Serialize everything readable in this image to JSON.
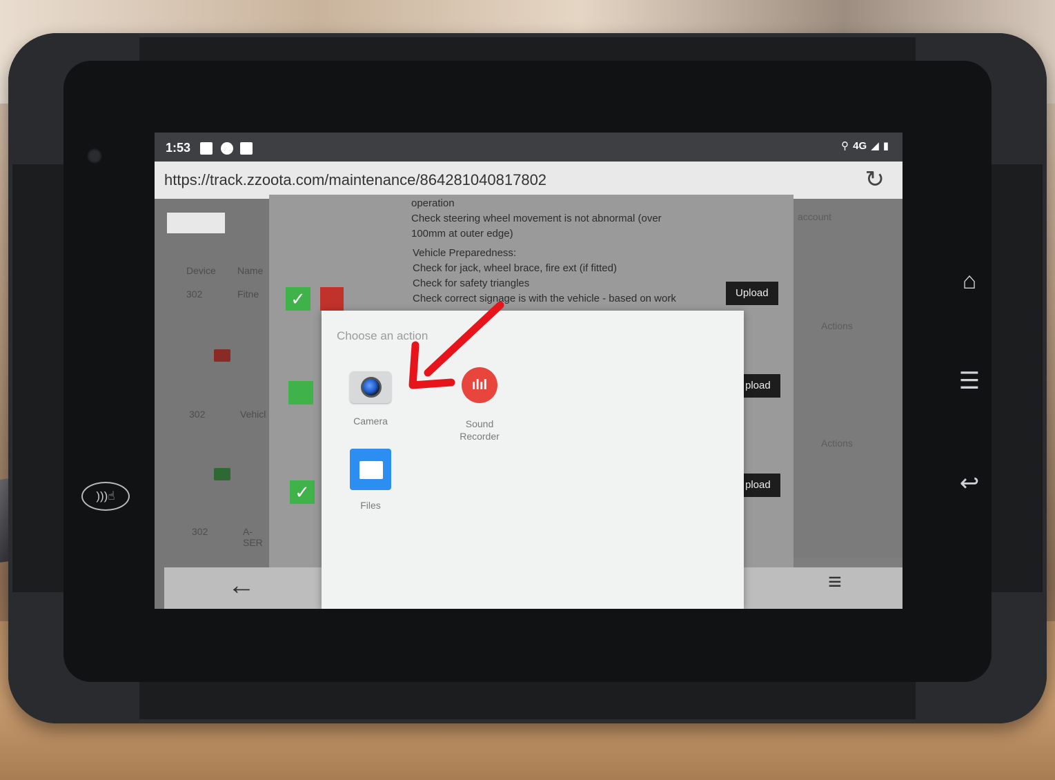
{
  "status_bar": {
    "time": "1:53",
    "network": "4G"
  },
  "browser": {
    "url": "https://track.zzoota.com/maintenance/864281040817802"
  },
  "left_table": {
    "headers": [
      "Device",
      "Name"
    ],
    "rows": [
      {
        "device": "302",
        "name": "Fitne"
      },
      {
        "device": "302",
        "name": "Vehicl"
      },
      {
        "device": "302",
        "name": "A-SER"
      }
    ]
  },
  "checklist": {
    "intro": "operation",
    "lines_a": [
      "Check steering wheel movement is not abnormal (over",
      "100mm at outer edge)"
    ],
    "heading_b": "Vehicle Preparedness:",
    "lines_b": [
      "Check for jack, wheel brace, fire ext (if fitted)",
      "Check for safety triangles",
      "Check correct signage is with the vehicle - based on work"
    ]
  },
  "upload_label": "Upload",
  "upload_label_partial": "pload",
  "right_panel": {
    "account": "account",
    "actions": "Actions"
  },
  "chooser": {
    "title": "Choose an action",
    "apps": [
      {
        "label": "Camera",
        "icon": "camera-icon"
      },
      {
        "label": "Sound\nRecorder",
        "icon": "sound-recorder-icon"
      },
      {
        "label": "Files",
        "icon": "files-icon"
      }
    ]
  },
  "colors": {
    "check_green": "#3fb24a",
    "reject_red": "#c0322b",
    "annotation_arrow": "#e8141b",
    "files_blue": "#2b8ef0",
    "recorder_red": "#e8453c"
  }
}
